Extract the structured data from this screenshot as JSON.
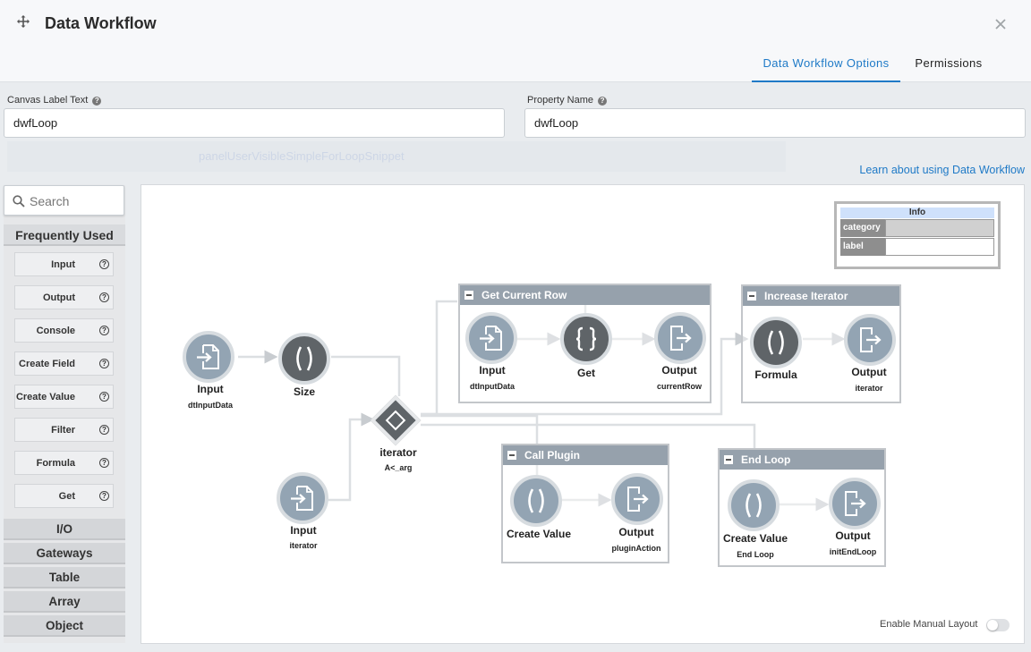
{
  "header": {
    "title": "Data Workflow",
    "tabs": [
      "Data Workflow Options",
      "Permissions"
    ]
  },
  "fields": {
    "canvas_label": {
      "label": "Canvas Label Text",
      "value": "dwfLoop"
    },
    "property_name": {
      "label": "Property Name",
      "value": "dwfLoop"
    }
  },
  "faded_text": "panelUserVisibleSimpleForLoopSnippet",
  "learn_link": "Learn about using Data Workflow",
  "sidebar": {
    "search_placeholder": "Search",
    "open_category": "Frequently Used",
    "items": [
      "Input",
      "Output",
      "Console",
      "Create Field",
      "Create Value",
      "Filter",
      "Formula",
      "Get"
    ],
    "categories": [
      "I/O",
      "Gateways",
      "Table",
      "Array",
      "Object"
    ]
  },
  "info_panel": {
    "title": "Info",
    "rows": [
      {
        "key": "category",
        "value": ""
      },
      {
        "key": "label",
        "value": ""
      }
    ]
  },
  "groups": {
    "get_current_row": "Get Current Row",
    "increase_iterator": "Increase Iterator",
    "call_plugin": "Call Plugin",
    "end_loop": "End Loop"
  },
  "nodes": {
    "input_dt": {
      "label": "Input",
      "sub": "dtInputData",
      "icon": "input-icon"
    },
    "size": {
      "label": "Size",
      "icon": "formula-icon"
    },
    "iterator": {
      "label": "iterator",
      "sub": "A<_arg",
      "icon": "diamond-icon"
    },
    "input_iter": {
      "label": "Input",
      "sub": "iterator",
      "icon": "input-icon"
    },
    "gcr_input": {
      "label": "Input",
      "sub": "dtInputData",
      "icon": "input-icon"
    },
    "gcr_get": {
      "label": "Get",
      "icon": "braces-icon"
    },
    "gcr_output": {
      "label": "Output",
      "sub": "currentRow",
      "icon": "output-icon"
    },
    "ii_formula": {
      "label": "Formula",
      "icon": "formula-icon"
    },
    "ii_output": {
      "label": "Output",
      "sub": "iterator",
      "icon": "output-icon"
    },
    "cp_create": {
      "label": "Create Value",
      "icon": "formula-icon"
    },
    "cp_output": {
      "label": "Output",
      "sub": "pluginAction",
      "icon": "output-icon"
    },
    "el_create": {
      "label": "Create Value",
      "sub": "End Loop",
      "icon": "formula-icon"
    },
    "el_output": {
      "label": "Output",
      "sub": "initEndLoop",
      "icon": "output-icon"
    }
  },
  "manual_layout": {
    "label": "Enable Manual Layout",
    "enabled": false
  },
  "colors": {
    "accent": "#1f7ac7",
    "node": "#93a4b3",
    "node_dark": "#5f6468",
    "group_header": "#96a1ac"
  }
}
